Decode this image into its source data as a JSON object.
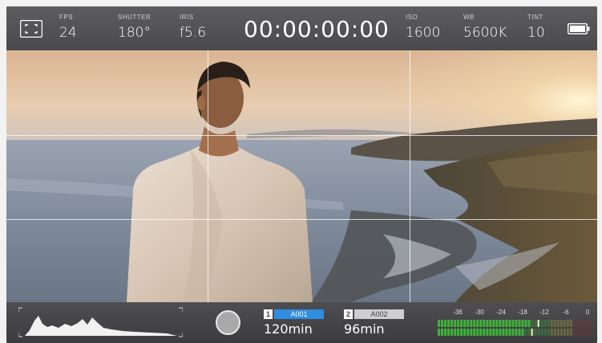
{
  "topbar": {
    "fullscreen_icon": "fullscreen-corners-icon",
    "fps": {
      "label": "FPS",
      "value": "24"
    },
    "shutter": {
      "label": "SHUTTER",
      "value": "180°"
    },
    "iris": {
      "label": "IRIS",
      "value": "f5.6"
    },
    "timecode": "00:00:00:00",
    "iso": {
      "label": "ISO",
      "value": "1600"
    },
    "wb": {
      "label": "WB",
      "value": "5600K"
    },
    "tint": {
      "label": "TINT",
      "value": "10"
    },
    "battery_icon": "battery-icon"
  },
  "viewer": {
    "overlay": "thirds-grid"
  },
  "bottombar": {
    "histogram_icon": "histogram",
    "record_icon": "record-button-icon",
    "slot1": {
      "index": "1",
      "clip": "A001",
      "remaining": "120min"
    },
    "slot2": {
      "index": "2",
      "clip": "A002",
      "remaining": "96min"
    },
    "audio_scale": [
      "-36",
      "-30",
      "-24",
      "-18",
      "-12",
      "-6",
      "0"
    ],
    "audio_levels": {
      "ch1": 0.6,
      "ch2": 0.56
    },
    "colors": {
      "slot_active": "#2f8de0",
      "meter_green": "#3fb23a",
      "meter_yellow": "#b4b030",
      "meter_red": "#8a2a2a"
    }
  }
}
